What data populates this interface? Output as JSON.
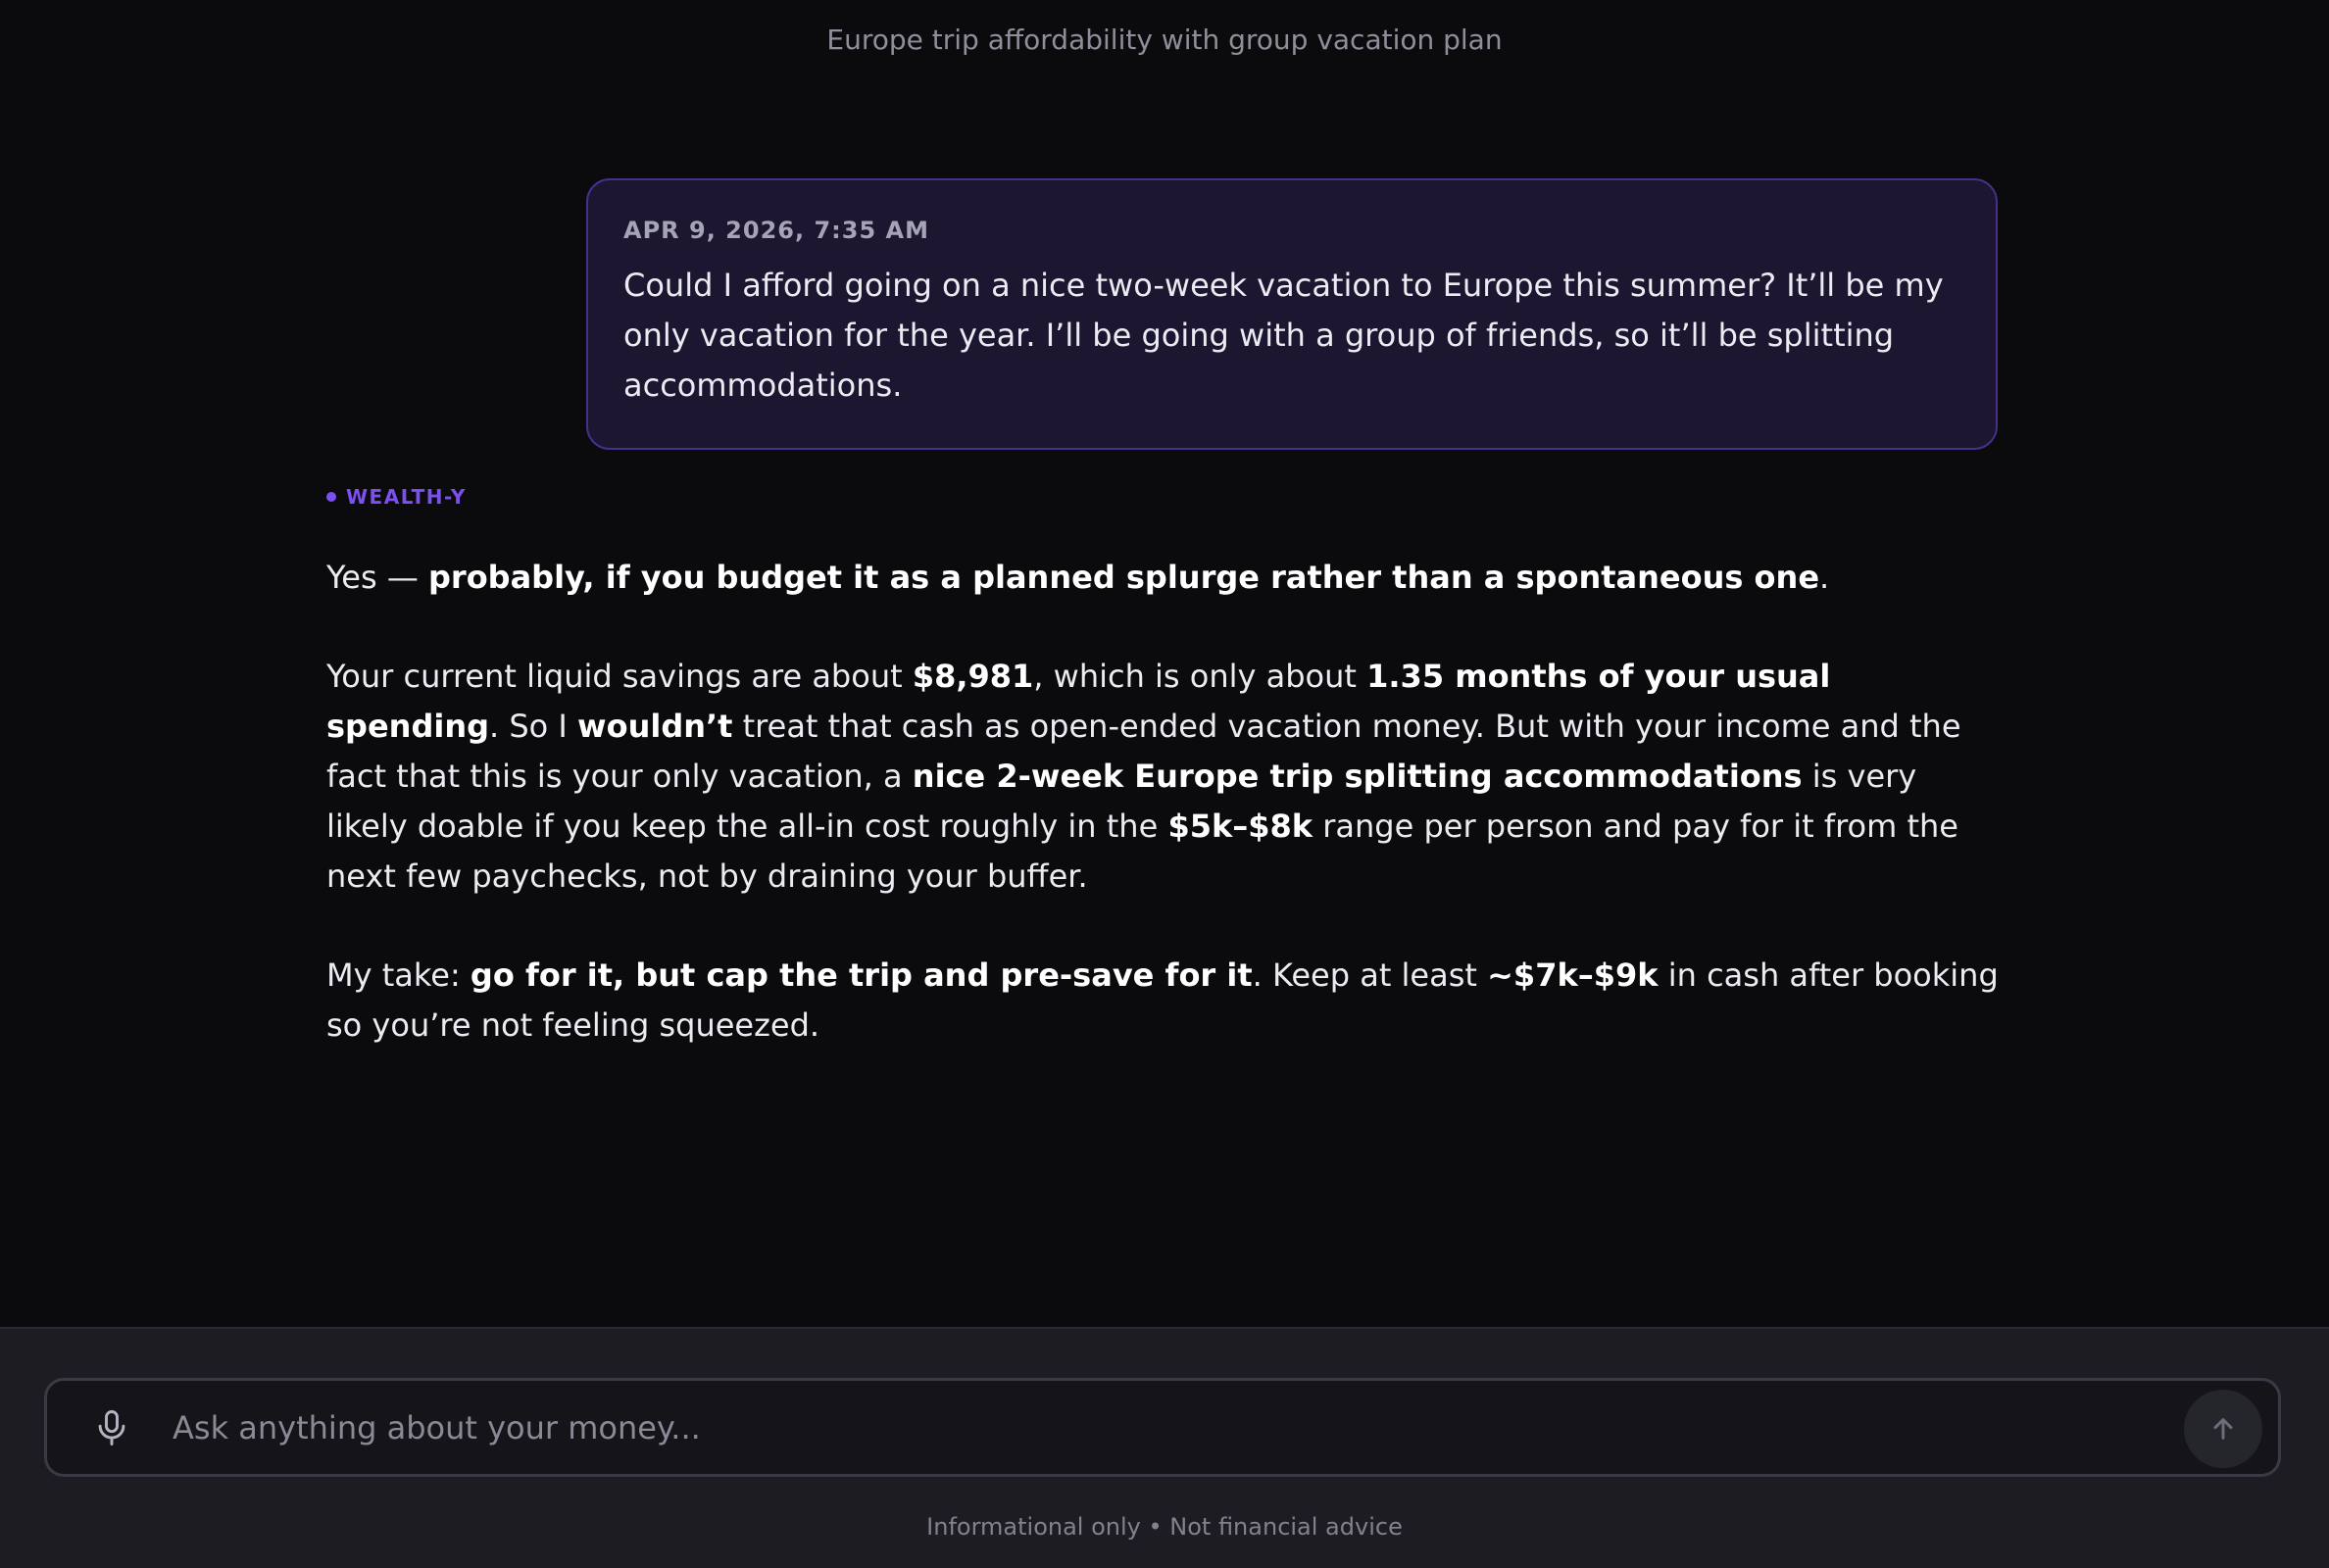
{
  "header": {
    "title": "Europe trip affordability with group vacation plan"
  },
  "user_message": {
    "timestamp": "APR 9, 2026, 7:35 AM",
    "text": "Could I afford going on a nice two-week vacation to Europe this summer? It’ll be my only vacation for the year. I’ll be going with a group of friends, so it’ll be splitting accommodations."
  },
  "assistant_message": {
    "label": "WEALTH-Y",
    "p1": {
      "t1": "Yes — ",
      "b1": "probably, if you budget it as a planned splurge rather than a spontaneous one",
      "t2": "."
    },
    "p2": {
      "t1": "Your current liquid savings are about ",
      "b1": "$8,981",
      "t2": ", which is only about ",
      "b2": "1.35 months of your usual spending",
      "t3": ". So I ",
      "b3": "wouldn’t",
      "t4": " treat that cash as open-ended vacation money. But with your income and the fact that this is your only vacation, a ",
      "b4": "nice 2-week Europe trip splitting accommodations",
      "t5": " is very likely doable if you keep the all-in cost roughly in the ",
      "b5": "$5k–$8k",
      "t6": " range per person and pay for it from the next few paychecks, not by draining your buffer."
    },
    "p3": {
      "t1": "My take: ",
      "b1": "go for it, but cap the trip and pre-save for it",
      "t2": ". Keep at least ",
      "b2": "~$7k–$9k",
      "t3": " in cash after booking so you’re not feeling squeezed."
    }
  },
  "composer": {
    "value": "",
    "placeholder": "Ask anything about your money...",
    "mic_icon": "microphone-icon",
    "send_icon": "arrow-up-icon"
  },
  "footer": {
    "disclaimer": "Informational only • Not financial advice"
  },
  "colors": {
    "background": "#0b0b0e",
    "accent": "#7c4ff0",
    "user_bubble": "#1c1631",
    "user_bubble_border": "#45318a"
  }
}
